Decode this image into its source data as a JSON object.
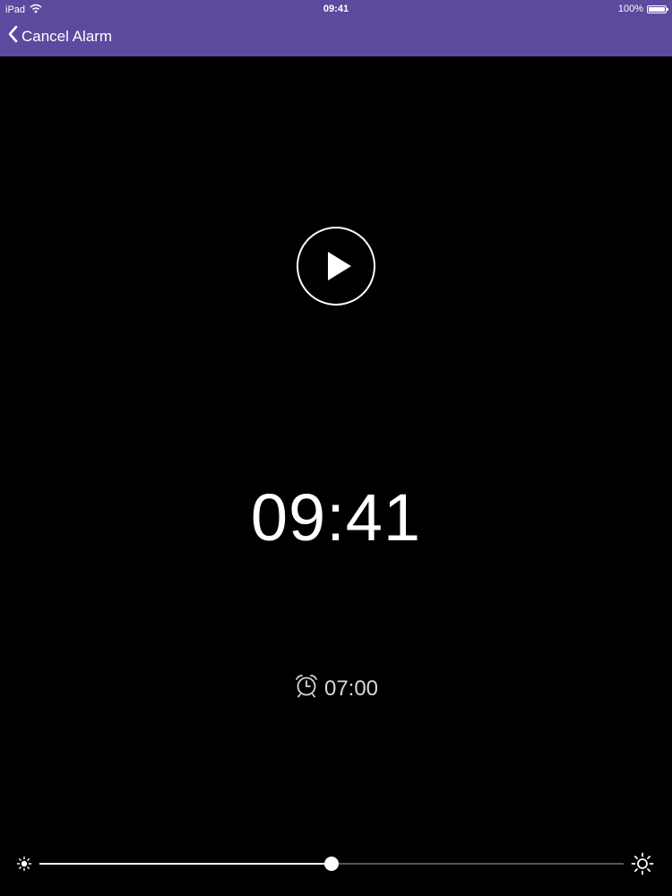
{
  "status_bar": {
    "device": "iPad",
    "time": "09:41",
    "battery": "100%"
  },
  "nav": {
    "back_label": "Cancel Alarm"
  },
  "clock": {
    "time": "09:41"
  },
  "alarm": {
    "time": "07:00",
    "icon": "alarm-clock-icon"
  },
  "brightness": {
    "level": 0.5,
    "min_icon": "sun-small-icon",
    "max_icon": "sun-large-icon"
  },
  "colors": {
    "nav_background": "#5b4a9e",
    "background": "#000000",
    "foreground": "#ffffff"
  }
}
